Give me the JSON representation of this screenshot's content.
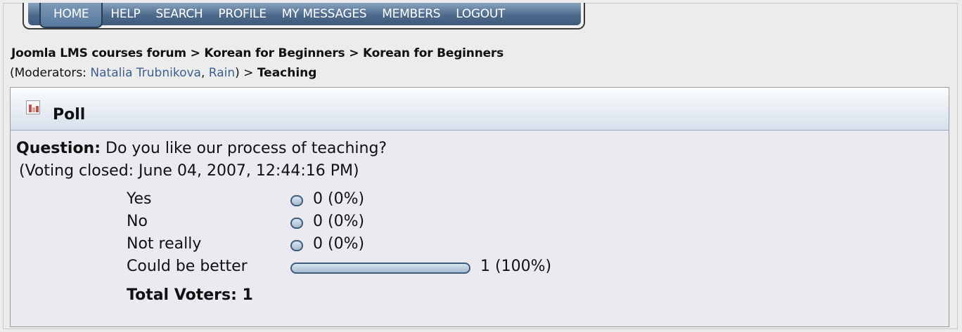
{
  "nav": {
    "items": [
      "HOME",
      "HELP",
      "SEARCH",
      "PROFILE",
      "MY MESSAGES",
      "MEMBERS",
      "LOGOUT"
    ]
  },
  "breadcrumb": {
    "forum": "Joomla LMS courses forum",
    "sep": ">",
    "category": "Korean for Beginners",
    "board": "Korean for Beginners",
    "moderators_prefix": "(Moderators:",
    "moderator1": "Natalia Trubnikova",
    "comma": ",",
    "moderator2": "Rain",
    "moderators_suffix": ")",
    "topic": "Teaching"
  },
  "poll": {
    "title": "Poll",
    "question_label": "Question:",
    "question": "Do you like our process of teaching?",
    "closed": "(Voting closed: June 04, 2007, 12:44:16 PM)",
    "options": [
      {
        "label": "Yes",
        "count": "0 (0%)",
        "fraction": 0
      },
      {
        "label": "No",
        "count": "0 (0%)",
        "fraction": 0
      },
      {
        "label": "Not really",
        "count": "0 (0%)",
        "fraction": 0
      },
      {
        "label": "Could be better",
        "count": "1 (100%)",
        "fraction": 1
      }
    ],
    "total": "Total Voters: 1"
  },
  "colors": {
    "nav": "#4d6a8c",
    "link": "#3d5f8f",
    "bar_border": "#3f5a7b"
  }
}
